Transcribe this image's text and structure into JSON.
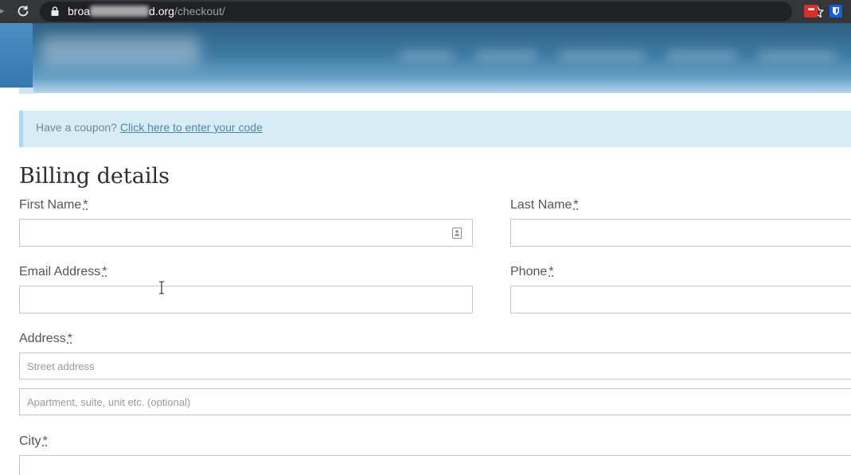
{
  "browser": {
    "url_host_start": "broa",
    "url_host_end": "d.org",
    "url_path": "/checkout/",
    "extension_badge": "•••"
  },
  "notice": {
    "text": "Have a coupon?",
    "link": "Click here to enter your code"
  },
  "billing": {
    "title": "Billing details",
    "required_mark": "*",
    "first_name_label": "First Name",
    "last_name_label": "Last Name",
    "email_label": "Email Address",
    "phone_label": "Phone",
    "address_label": "Address",
    "street_placeholder": "Street address",
    "apartment_placeholder": "Apartment, suite, unit etc. (optional)",
    "city_label": "City"
  },
  "icons": {
    "reload": "reload-icon",
    "lock": "lock-icon",
    "star": "bookmark-star-icon",
    "contact": "contact-card-icon",
    "cursor": "text-cursor-icon"
  },
  "colors": {
    "notice_bg": "#d8ecf6",
    "link": "#4e86ac",
    "header": "#3d7aa3"
  }
}
